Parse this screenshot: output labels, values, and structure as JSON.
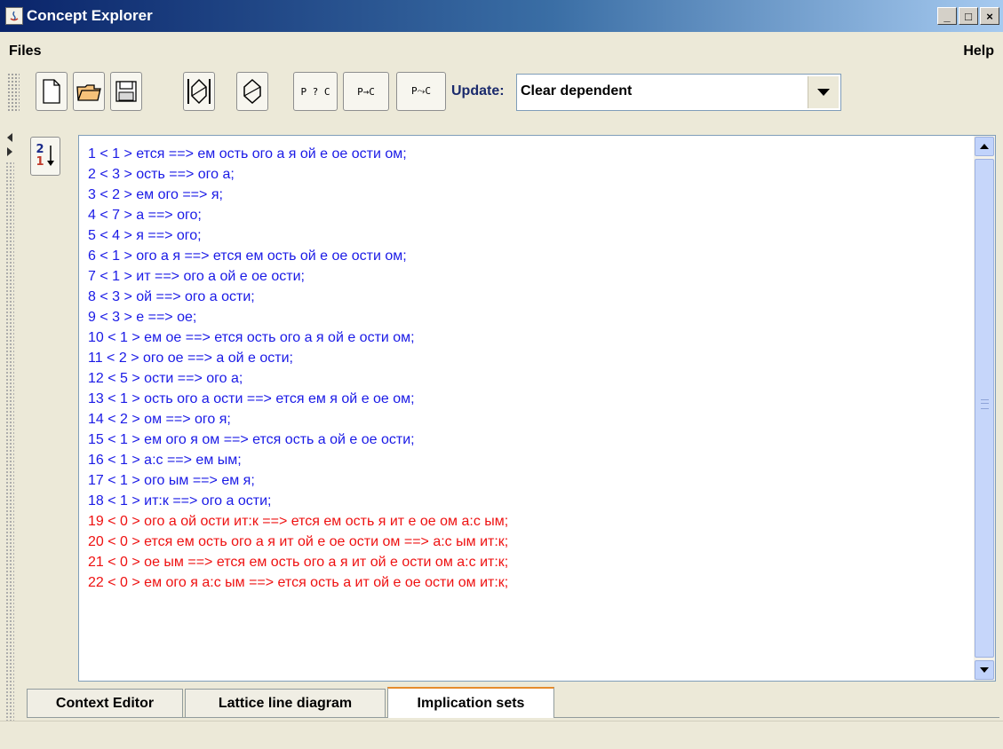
{
  "window": {
    "title": "Concept Explorer",
    "controls": [
      "_",
      "□",
      "×"
    ]
  },
  "menu": {
    "files": "Files",
    "help": "Help"
  },
  "toolbar": {
    "buttons": [
      {
        "name": "new-file",
        "label": ""
      },
      {
        "name": "open-folder",
        "label": ""
      },
      {
        "name": "save",
        "label": ""
      },
      {
        "name": "lattice-full",
        "label": ""
      },
      {
        "name": "lattice",
        "label": ""
      },
      {
        "name": "p-query-c",
        "label": "P ? C"
      },
      {
        "name": "p-implies-c",
        "label": "P→C"
      },
      {
        "name": "p-derive-c",
        "label": "P⤳C"
      }
    ],
    "update_label": "Update:",
    "update_value": "Clear dependent"
  },
  "sort_icon": {
    "top": "2",
    "bottom": "1"
  },
  "implications": [
    {
      "text": "1 < 1 > ется ==> ем ость ого а я ой е ое ости ом;",
      "color": "blue"
    },
    {
      "text": "2 < 3 > ость ==> ого а;",
      "color": "blue"
    },
    {
      "text": "3 < 2 > ем ого ==> я;",
      "color": "blue"
    },
    {
      "text": "4 < 7 > а ==> ого;",
      "color": "blue"
    },
    {
      "text": "5 < 4 > я ==> ого;",
      "color": "blue"
    },
    {
      "text": "6 < 1 > ого а я ==> ется ем ость ой е ое ости ом;",
      "color": "blue"
    },
    {
      "text": "7 < 1 > ит ==> ого а ой е ое ости;",
      "color": "blue"
    },
    {
      "text": "8 < 3 > ой ==> ого а ости;",
      "color": "blue"
    },
    {
      "text": "9 < 3 > е ==> ое;",
      "color": "blue"
    },
    {
      "text": "10 < 1 > ем ое ==> ется ость ого а я ой е ости ом;",
      "color": "blue"
    },
    {
      "text": "11 < 2 > ого ое ==> а ой е ости;",
      "color": "blue"
    },
    {
      "text": "12 < 5 > ости ==> ого а;",
      "color": "blue"
    },
    {
      "text": "13 < 1 > ость ого а ости ==> ется ем я ой е ое ом;",
      "color": "blue"
    },
    {
      "text": "14 < 2 > ом ==> ого я;",
      "color": "blue"
    },
    {
      "text": "15 < 1 > ем ого я ом ==> ется ость а ой е ое ости;",
      "color": "blue"
    },
    {
      "text": "16 < 1 > а:с ==> ем ым;",
      "color": "blue"
    },
    {
      "text": "17 < 1 > ого ым ==> ем я;",
      "color": "blue"
    },
    {
      "text": "18 < 1 > ит:к ==> ого а ости;",
      "color": "blue"
    },
    {
      "text": "19 < 0 > ого а ой ости ит:к ==> ется ем ость я ит е ое ом а:с ым;",
      "color": "red"
    },
    {
      "text": "20 < 0 > ется ем ость ого а я ит ой е ое ости ом ==> а:с ым ит:к;",
      "color": "red"
    },
    {
      "text": "21 < 0 > ое ым ==> ется ем ость ого а я ит ой е ости ом а:с ит:к;",
      "color": "red"
    },
    {
      "text": "22 < 0 > ем ого я а:с ым ==> ется ость а ит ой е ое ости ом ит:к;",
      "color": "red"
    }
  ],
  "tabs": [
    {
      "label": "Context Editor",
      "active": false
    },
    {
      "label": "Lattice line diagram",
      "active": false
    },
    {
      "label": "Implication sets",
      "active": true
    }
  ],
  "colors": {
    "blue_text": "#1a1ae6",
    "red_text": "#ee1111",
    "active_tab_accent": "#e68b2c"
  }
}
